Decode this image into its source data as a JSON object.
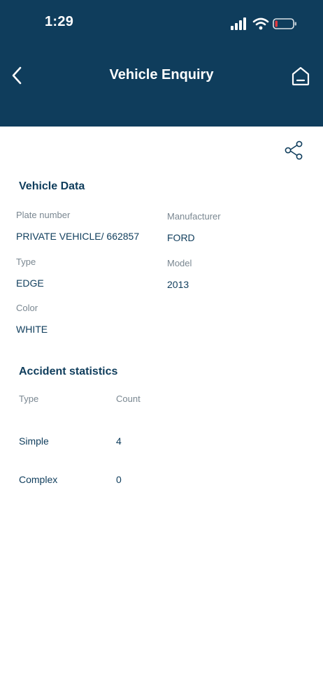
{
  "status_bar": {
    "time": "1:29"
  },
  "header": {
    "title": "Vehicle Enquiry",
    "back_icon": "chevron-left-icon",
    "home_icon": "home-icon"
  },
  "toolbar": {
    "share_icon": "share-icon"
  },
  "vehicle_data": {
    "title": "Vehicle Data",
    "fields": {
      "plate_number": {
        "label": "Plate number",
        "value": "PRIVATE VEHICLE/ 662857"
      },
      "manufacturer": {
        "label": "Manufacturer",
        "value": "FORD"
      },
      "type": {
        "label": "Type",
        "value": "EDGE"
      },
      "model": {
        "label": "Model",
        "value": "2013"
      },
      "color": {
        "label": "Color",
        "value": "WHITE"
      }
    }
  },
  "accident_statistics": {
    "title": "Accident statistics",
    "columns": [
      "Type",
      "Count"
    ],
    "rows": [
      {
        "type": "Simple",
        "count": "4"
      },
      {
        "type": "Complex",
        "count": "0"
      }
    ]
  },
  "colors": {
    "header_bg": "#0f3d5c",
    "text_primary": "#0f3d5c",
    "text_secondary": "#7a8791",
    "battery_low": "#e0383e"
  }
}
